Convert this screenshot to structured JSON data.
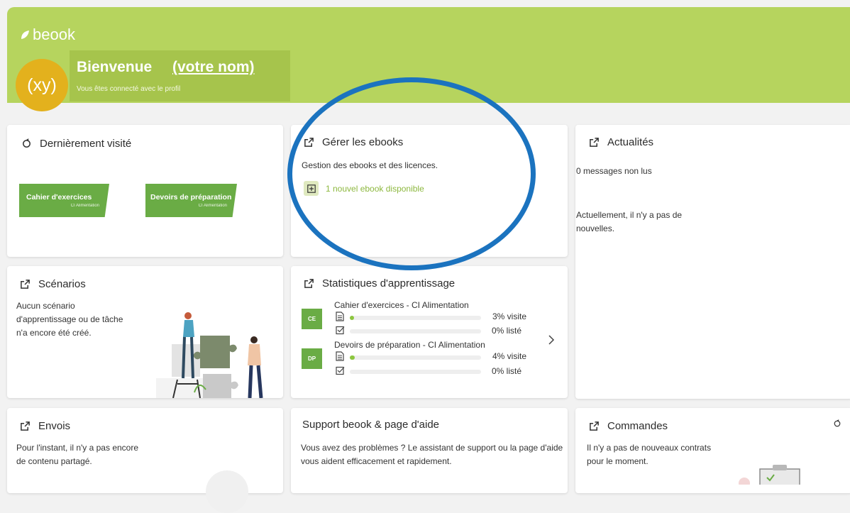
{
  "header": {
    "logo_text": "beook",
    "avatar_initials": "(xy)",
    "welcome_title": "Bienvenue",
    "welcome_name": "(votre nom)",
    "welcome_subtitle": "Vous êtes connecté avec le profil"
  },
  "recent": {
    "title": "Dernièrement visité",
    "tiles": [
      {
        "label": "Cahier d'exercices",
        "sub": "CI Alimentation"
      },
      {
        "label": "Devoirs de préparation",
        "sub": "CI Alimentation"
      }
    ]
  },
  "ebooks": {
    "title": "Gérer les ebooks",
    "description": "Gestion des ebooks et des licences.",
    "new_ebook_link": "1 nouvel ebook disponible"
  },
  "news": {
    "title": "Actualités",
    "unread": "0 messages non lus",
    "empty": "Actuellement, il n'y a pas de nouvelles."
  },
  "scenarios": {
    "title": "Scénarios",
    "empty": "Aucun scénario d'apprentissage ou de tâche n'a encore été créé."
  },
  "stats": {
    "title": "Statistiques d'apprentissage",
    "books": [
      {
        "badge": "CE",
        "name": "Cahier d'exercices - CI Alimentation",
        "visit_label": "3% visite",
        "visit": 0.03,
        "listed_label": "0% listé",
        "listed": 0.0
      },
      {
        "badge": "DP",
        "name": "Devoirs de préparation - CI Alimentation",
        "visit_label": "4% visite",
        "visit": 0.04,
        "listed_label": "0% listé",
        "listed": 0.0
      }
    ]
  },
  "envois": {
    "title": "Envois",
    "empty": "Pour l'instant, il n'y a pas encore de contenu partagé."
  },
  "support": {
    "title": "Support beook & page d'aide",
    "text": "Vous avez des problèmes ? Le assistant de support ou la page d'aide vous aident efficacement et rapidement."
  },
  "orders": {
    "title": "Commandes",
    "empty": "Il n'y a pas de nouveaux contrats pour le moment."
  },
  "colors": {
    "banner": "#b6d45e",
    "accent_green": "#6aac45",
    "avatar": "#e3b11d",
    "highlight_ring": "#1b73bf"
  }
}
